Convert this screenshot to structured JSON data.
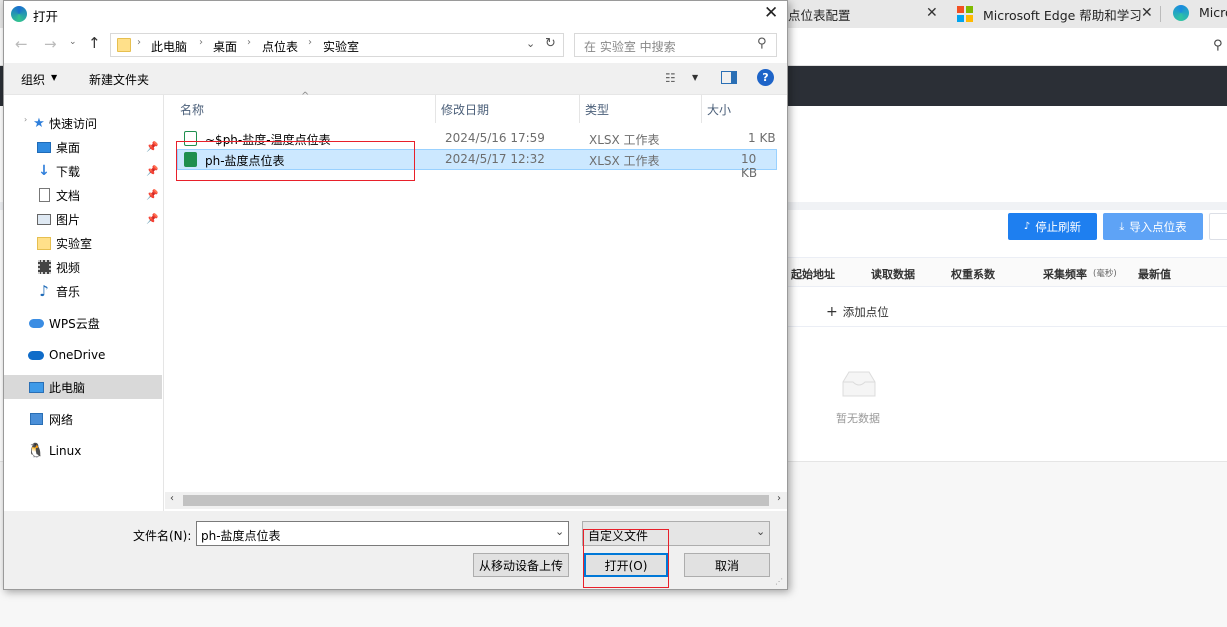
{
  "browser": {
    "tabs": [
      {
        "label": "点位表配置"
      },
      {
        "label": "Microsoft Edge 帮助和学习"
      },
      {
        "label": "Micro"
      }
    ],
    "buttons": {
      "stop_refresh": "停止刷新",
      "import_points": "导入点位表"
    },
    "table_headers": [
      "起始地址",
      "读取数据",
      "权重系数",
      "采集频率",
      "最新值"
    ],
    "table_header_unit": "(毫秒)",
    "add_point": "添加点位",
    "empty_text": "暂无数据"
  },
  "dialog": {
    "title": "打开",
    "breadcrumb": [
      "此电脑",
      "桌面",
      "点位表",
      "实验室"
    ],
    "search_placeholder": "在 实验室 中搜索",
    "toolbar": {
      "organize": "组织",
      "new_folder": "新建文件夹"
    },
    "nav": {
      "quick_access": "快速访问",
      "items": [
        "桌面",
        "下载",
        "文档",
        "图片",
        "实验室",
        "视频",
        "音乐"
      ],
      "wps": "WPS云盘",
      "onedrive": "OneDrive",
      "this_pc": "此电脑",
      "network": "网络",
      "linux": "Linux"
    },
    "columns": {
      "name": "名称",
      "modified": "修改日期",
      "type": "类型",
      "size": "大小"
    },
    "files": [
      {
        "name": "~$ph-盐度-温度点位表",
        "modified": "2024/5/16 17:59",
        "type": "XLSX 工作表",
        "size": "1 KB"
      },
      {
        "name": "ph-盐度点位表",
        "modified": "2024/5/17 12:32",
        "type": "XLSX 工作表",
        "size": "10 KB"
      }
    ],
    "filename_label": "文件名(N):",
    "filename_value": "ph-盐度点位表",
    "filetype_value": "自定义文件",
    "buttons": {
      "upload": "从移动设备上传",
      "open": "打开(O)",
      "cancel": "取消"
    }
  }
}
